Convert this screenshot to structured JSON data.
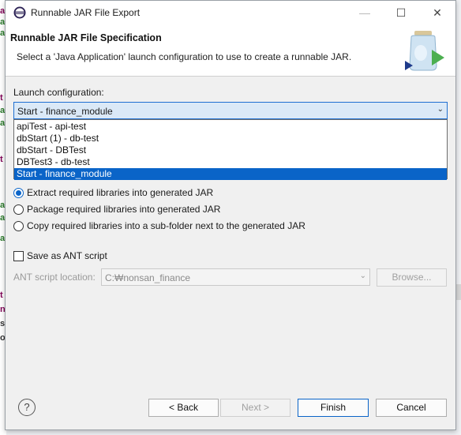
{
  "window": {
    "title": "Runnable JAR File Export",
    "minimize": "—",
    "maximize": "☐",
    "close": "✕"
  },
  "header": {
    "title": "Runnable JAR File Specification",
    "description": "Select a 'Java Application' launch configuration to use to create a runnable JAR."
  },
  "launch": {
    "label": "Launch configuration:",
    "value": "Start - finance_module",
    "arrow": "⌄",
    "options": [
      "apiTest - api-test",
      "dbStart (1) - db-test",
      "dbStart - DBTest",
      "DBTest3 - db-test",
      "Start - finance_module"
    ],
    "selected_index": 4
  },
  "library_handling": {
    "options": [
      {
        "label": "Extract required libraries into generated JAR",
        "checked": true
      },
      {
        "label": "Package required libraries into generated JAR",
        "checked": false
      },
      {
        "label": "Copy required libraries into a sub-folder next to the generated JAR",
        "checked": false
      }
    ]
  },
  "ant": {
    "save_label": "Save as ANT script",
    "save_checked": false,
    "location_label": "ANT script location:",
    "location_value": "C:₩nonsan_finance",
    "arrow": "⌄",
    "browse": "Browse..."
  },
  "footer": {
    "help": "?",
    "back": "< Back",
    "next": "Next >",
    "finish": "Finish",
    "cancel": "Cancel"
  },
  "background_chars": [
    "a",
    "a",
    "a",
    "t",
    "a",
    "a",
    "t",
    "a",
    "a",
    "a",
    "t",
    "n",
    "s",
    "o"
  ],
  "colors": {
    "accent": "#0a64c8",
    "combo_bg": "#dbe9f7"
  }
}
